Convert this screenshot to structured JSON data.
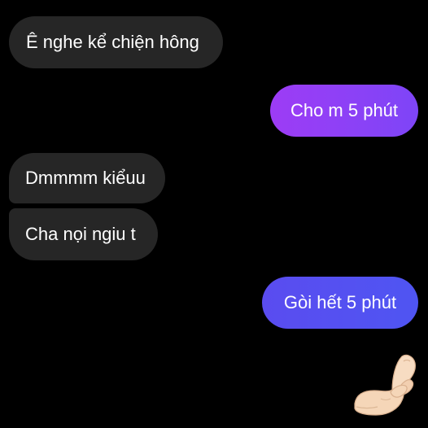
{
  "conversation": {
    "messages": [
      {
        "sender": "them",
        "text": "Ê nghe kể chiện hông"
      },
      {
        "sender": "me",
        "text": "Cho m 5 phút"
      },
      {
        "sender": "them",
        "text": "Dmmmm kiểuu"
      },
      {
        "sender": "them",
        "text": "Cha nọi ngiu t"
      },
      {
        "sender": "me",
        "text": "Gòi hết 5 phút"
      }
    ],
    "reaction": {
      "icon": "pinched-fingers-icon",
      "skin_tone": "#f5d6b8"
    }
  },
  "colors": {
    "background": "#000000",
    "incoming_bubble": "#262626",
    "outgoing_bubble_top": "#9d3cf5",
    "outgoing_bubble_bottom": "#4f55f2",
    "text": "#ffffff"
  }
}
